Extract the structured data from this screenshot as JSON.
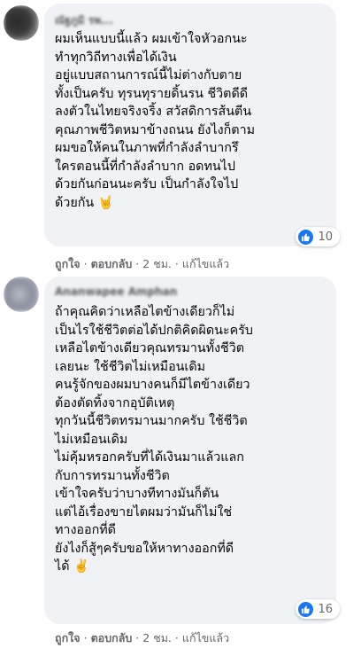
{
  "icons": {
    "like": "thumbs-up-icon",
    "horns": "sign-of-horns-emoji",
    "victory": "victory-hand-emoji"
  },
  "colors": {
    "bubble": "#f0f2f5",
    "like_blue": "#1877f2",
    "meta_gray": "#65676b"
  },
  "comments": [
    {
      "author": "ณัฐภูมิ รพ...",
      "lines": [
        "ผมเห็นแบบนี้แล้ว ผมเข้าใจหัวอกนะ",
        "ทำทุกวิถีทางเพื่อได้เงิน",
        "อยู่แบบสถานการณ์นี้ไม่ต่างกับตาย",
        "ทั้งเป็นครับ ทุรนทุรายดิ้นรน ชีวิตดีดี",
        "ลงตัวในไทยจริงจริ้ง สวัสดิการส้นตีน",
        "คุณภาพชีวิตหมาข้างถนน ยังไงก็ตาม",
        "ผมขอให้คนในภาพที่กำลังลำบากรึ",
        "ใครตอนนี้ที่กำลังลำบาก อดทนไป",
        "ด้วยกันก่อนนะครับ เป็นกำลังใจไป",
        "ด้วยกัน"
      ],
      "emoji": "🤘",
      "reaction_count": "10",
      "like": "ถูกใจ",
      "reply": "ตอบกลับ",
      "time": "2 ชม.",
      "edited": "แก้ไขแล้ว"
    },
    {
      "author": "Ananwapee Amphan",
      "lines": [
        "ถ้าคุณคิดว่าเหลือไตข้างเดียวก็ไม่",
        "เป็นไรใช้ชีวิตต่อได้ปกติคิดผิดนะครับ",
        "เหลือไตข้างเดียวคุณทรมานทั้งชีวิต",
        "เลยนะ ใช้ชีวิตไม่เหมือนเดิม",
        "คนรู้จักของผมบางคนก็มีไตข้างเดียว",
        "ต้องตัดทิ้งจากอุบัติเหตุ",
        "ทุกวันนี้ชีวิตทรมานมากครับ ใช้ชีวิต",
        "ไม่เหมือนเดิม",
        "ไม่คุ้มหรอกครับที่ได้เงินมาแล้วแลก",
        "กับการทรมานทั้งชีวิต",
        "เข้าใจครับว่าบางทีทางมันก็ตัน",
        "แต่ไอ้เรื่องขายไตผมว่ามันก็ไม่ใช่",
        "ทางออกที่ดี",
        "ยังไงก็สู้ๆครับขอให้หาทางออกที่ดี",
        "ได้"
      ],
      "emoji": "✌️",
      "reaction_count": "16",
      "like": "ถูกใจ",
      "reply": "ตอบกลับ",
      "time": "2 ชม.",
      "edited": "แก้ไขแล้ว"
    }
  ]
}
